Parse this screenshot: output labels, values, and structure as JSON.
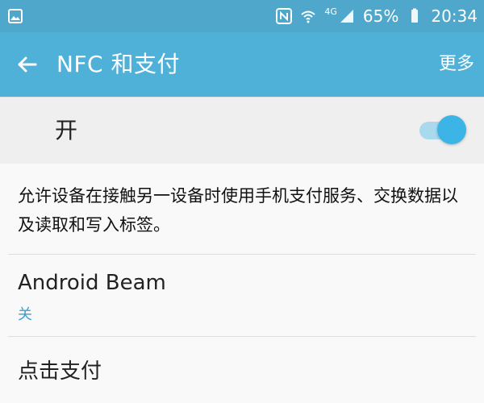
{
  "status_bar": {
    "left_icon": "image-icon",
    "icons": [
      "nfc-icon",
      "wifi-icon",
      "signal-icon",
      "battery-icon"
    ],
    "network_type": "4G",
    "battery_percent": "65%",
    "time": "20:34"
  },
  "app_bar": {
    "back_icon": "arrow-left-icon",
    "title": "NFC 和支付",
    "more_label": "更多"
  },
  "nfc_switch": {
    "label": "开",
    "enabled": true
  },
  "description": "允许设备在接触另一设备时使用手机支付服务、交换数据以及读取和写入标签。",
  "items": [
    {
      "title": "Android Beam",
      "subtitle": "关"
    },
    {
      "title": "点击支付"
    }
  ],
  "colors": {
    "status_bar_bg": "#4fa8cc",
    "app_bar_bg": "#4fb0d8",
    "accent": "#3aa0d0",
    "toggle_thumb": "#3cb4e6",
    "toggle_track": "#a9d9ed"
  }
}
